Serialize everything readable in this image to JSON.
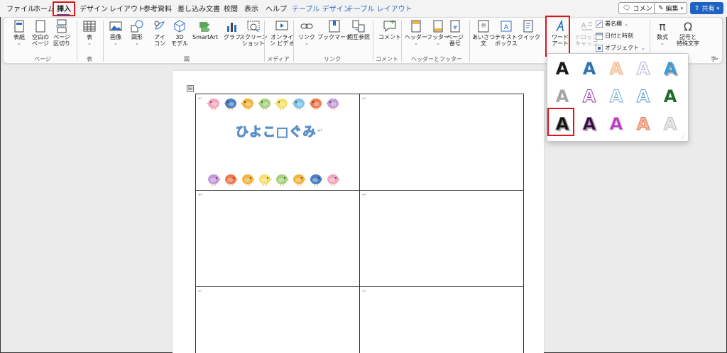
{
  "tabs": [
    {
      "label": "ファイル",
      "state": "normal"
    },
    {
      "label": "ホーム",
      "state": "normal"
    },
    {
      "label": "挿入",
      "state": "active"
    },
    {
      "label": "デザイン",
      "state": "normal"
    },
    {
      "label": "レイアウト",
      "state": "normal"
    },
    {
      "label": "参考資料",
      "state": "normal"
    },
    {
      "label": "差し込み文書",
      "state": "normal"
    },
    {
      "label": "校閲",
      "state": "normal"
    },
    {
      "label": "表示",
      "state": "normal"
    },
    {
      "label": "ヘルプ",
      "state": "normal"
    },
    {
      "label": "テーブル デザイン",
      "state": "contextual"
    },
    {
      "label": "テーブル レイアウト",
      "state": "contextual"
    }
  ],
  "top_right": {
    "comment": "コメント",
    "edit": "編集",
    "share": "共有"
  },
  "ribbon": {
    "pages": {
      "cover": [
        "表紙"
      ],
      "blank": [
        "空白の",
        "ページ"
      ],
      "break": [
        "ページ",
        "区切り"
      ],
      "group": "ページ"
    },
    "table": {
      "table": [
        "表"
      ],
      "group": "表"
    },
    "illustrations": {
      "picture": [
        "画像"
      ],
      "shapes": [
        "図形"
      ],
      "icons": [
        "アイ",
        "コン"
      ],
      "model3d": [
        "3D",
        "モデル"
      ],
      "smartart": [
        "SmartArt"
      ],
      "chart": [
        "グラフ"
      ],
      "screenshot": [
        "スクリーン",
        "ショット"
      ],
      "group": "図"
    },
    "media": {
      "online_video": [
        "オンライ",
        "ン ビデオ"
      ],
      "group": "メディア"
    },
    "links": {
      "link": [
        "リンク"
      ],
      "bookmark": [
        "ブックマーク"
      ],
      "crossref": [
        "相互参照"
      ],
      "group": "リンク"
    },
    "comments": {
      "comment": [
        "コメント"
      ],
      "group": "コメント"
    },
    "header_footer": {
      "header": [
        "ヘッダー"
      ],
      "footer": [
        "フッター"
      ],
      "page_number": [
        "ページ",
        "番号"
      ],
      "group": "ヘッダーとフッター"
    },
    "text": {
      "greeting": [
        "あいさつ",
        "文"
      ],
      "textbox": [
        "テキスト",
        "ボックス"
      ],
      "quick_parts": [
        "クイック",
        "パーツ"
      ],
      "wordart": [
        "ワード",
        "アート"
      ],
      "dropcap": [
        "ドロップ",
        "キャップ"
      ],
      "signature": "署名欄",
      "datetime": "日付と時刻",
      "object": "オブジェクト"
    },
    "symbols": {
      "equation": [
        "数式"
      ],
      "symbol": [
        "記号と",
        "特殊文字"
      ],
      "group_tail": "字"
    }
  },
  "document": {
    "label_title": "ひよこ□ぐみ",
    "cell_mark": "↵",
    "handle": "⊞"
  },
  "bird_colors_top": [
    "#f4a6c0",
    "#4b7fc6",
    "#f2b43e",
    "#a5d27a",
    "#f5e06a",
    "#7cc3e8",
    "#ef7a4f",
    "#c29ad8"
  ],
  "bird_colors_bottom": [
    "#c29ad8",
    "#ef7a4f",
    "#f2b43e",
    "#f5e06a",
    "#a5d27a",
    "#f2b43e",
    "#4b7fc6",
    "#f4a6c0"
  ],
  "wordart_gallery": {
    "glyph": "A",
    "styles": [
      {
        "name": "fill-black",
        "fill": "#1a1a1a",
        "stroke": "none"
      },
      {
        "name": "fill-blue-accent",
        "fill": "#2e74b5",
        "stroke": "none"
      },
      {
        "name": "fill-orange-outline",
        "fill": "#fbd5b5",
        "stroke": "#f4b183"
      },
      {
        "name": "fill-white-outline-lavender",
        "fill": "#ffffff",
        "stroke": "#b4a7d6"
      },
      {
        "name": "fill-blue-shadow",
        "fill": "#3c9ad6",
        "stroke": "none"
      },
      {
        "name": "fill-gray",
        "fill": "#a6a6a6",
        "stroke": "none"
      },
      {
        "name": "outline-purple",
        "fill": "#ffffff",
        "stroke": "#9b3eb0"
      },
      {
        "name": "outline-lightblue",
        "fill": "#ffffff",
        "stroke": "#6faed8"
      },
      {
        "name": "outline-lightblue-2",
        "fill": "#ffffff",
        "stroke": "#5b9bd5"
      },
      {
        "name": "fill-green",
        "fill": "#1f6b2a",
        "stroke": "none"
      },
      {
        "name": "fill-black-shadow",
        "fill": "#111111",
        "stroke": "#666666"
      },
      {
        "name": "fill-black-purple-shadow",
        "fill": "#2a1030",
        "stroke": "#b06bbf"
      },
      {
        "name": "fill-magenta",
        "fill": "#b43cb8",
        "stroke": "#e8a0ec"
      },
      {
        "name": "fill-orange-bevel",
        "fill": "#f6b8a0",
        "stroke": "#e07a50"
      },
      {
        "name": "fill-silver",
        "fill": "#e6e6e6",
        "stroke": "#bfbfbf"
      }
    ]
  },
  "colors": {
    "accent": "#185abd",
    "highlight": "#e0141b"
  }
}
